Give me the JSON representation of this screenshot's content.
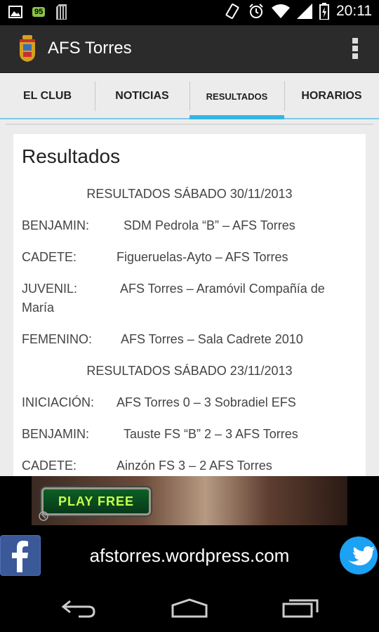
{
  "status_bar": {
    "battery_badge": "95",
    "time": "20:11",
    "icons": [
      "image-icon",
      "sd-card-icon",
      "vibrate-icon",
      "alarm-icon",
      "wifi-icon",
      "signal-icon",
      "battery-charging-icon"
    ]
  },
  "app_bar": {
    "title": "AFS Torres",
    "icons": [
      "crest-icon",
      "overflow-menu-icon"
    ]
  },
  "tabs": [
    {
      "label": "EL CLUB",
      "active": false
    },
    {
      "label": "NOTICIAS",
      "active": false
    },
    {
      "label": "RESULTADOS",
      "active": true
    },
    {
      "label": "HORARIOS",
      "active": false
    }
  ],
  "content": {
    "heading": "Resultados",
    "sections": [
      {
        "title": "RESULTADOS SÁBADO 30/11/2013",
        "rows": [
          {
            "category": "BENJAMIN:",
            "match": "SDM Pedrola “B” – AFS Torres"
          },
          {
            "category": "CADETE:",
            "match": "Figueruelas-Ayto – AFS Torres"
          },
          {
            "category": "JUVENIL:",
            "match": "AFS Torres – Aramóvil Compañía de",
            "match_cont": "María"
          },
          {
            "category": "FEMENINO:",
            "match": "AFS Torres – Sala Cadrete 2010"
          }
        ]
      },
      {
        "title": "RESULTADOS SÁBADO 23/11/2013",
        "rows": [
          {
            "category": "INICIACIÓN:",
            "match": "AFS Torres 0 – 3 Sobradiel EFS"
          },
          {
            "category": "BENJAMIN:",
            "match": "Tauste FS “B” 2 – 3 AFS Torres"
          },
          {
            "category": "CADETE:",
            "match": "Ainzón FS 3 – 2 AFS Torres"
          }
        ]
      }
    ]
  },
  "ad_banner": {
    "button_label": "PLAY FREE"
  },
  "footer": {
    "url": "afstorres.wordpress.com",
    "icons": [
      "facebook-icon",
      "twitter-icon"
    ]
  },
  "navigation": {
    "icons": [
      "back-icon",
      "home-icon",
      "recent-apps-icon"
    ]
  },
  "colors": {
    "accent": "#33b5e5",
    "app_bar": "#2b2b2b",
    "facebook": "#3b5998",
    "twitter": "#1da1f2"
  }
}
